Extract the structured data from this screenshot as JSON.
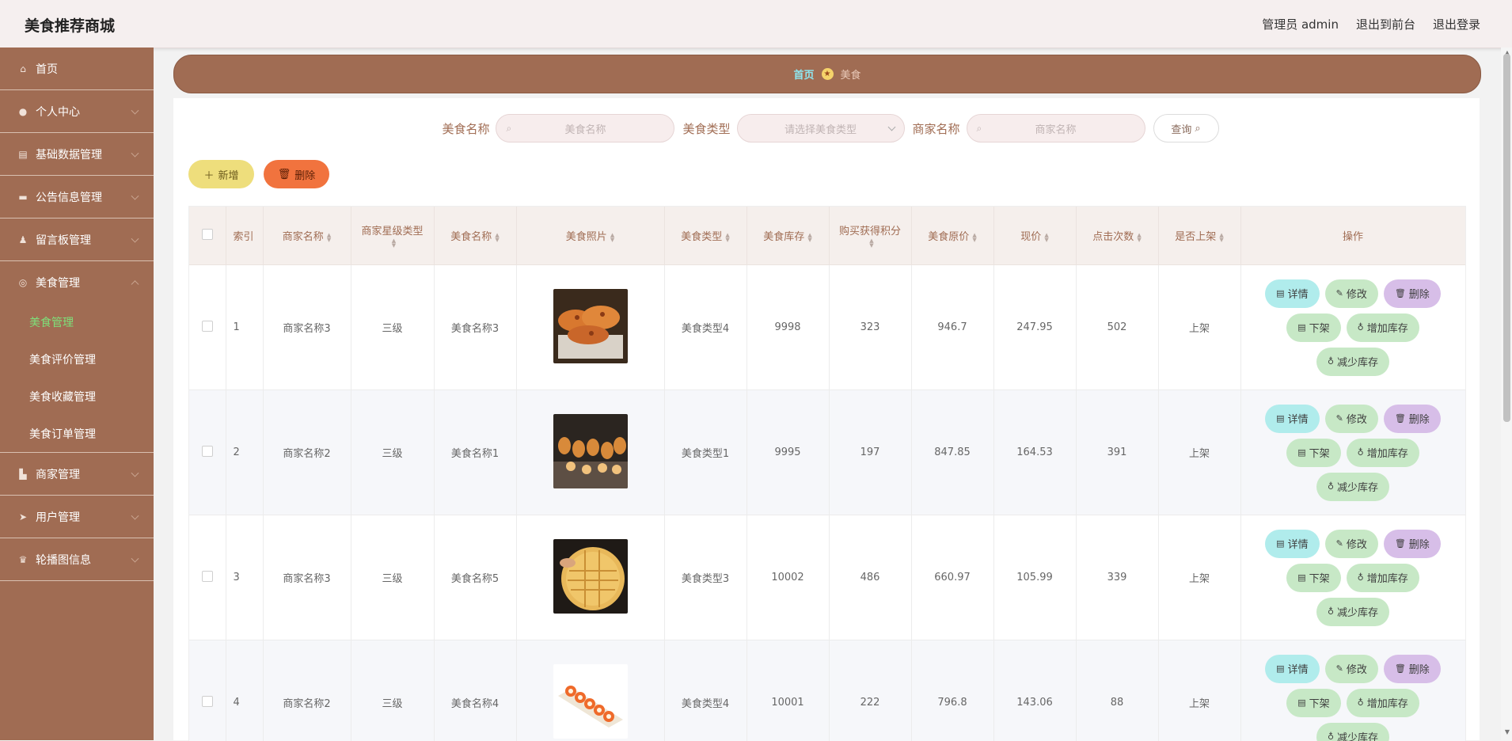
{
  "header": {
    "app_title": "美食推荐商城",
    "admin_label": "管理员 admin",
    "front_link": "退出到前台",
    "logout_link": "退出登录"
  },
  "sidebar": {
    "items": [
      {
        "label": "首页",
        "icon": "home-icon"
      },
      {
        "label": "个人中心",
        "icon": "user-icon"
      },
      {
        "label": "基础数据管理",
        "icon": "clipboard-icon"
      },
      {
        "label": "公告信息管理",
        "icon": "truck-icon"
      },
      {
        "label": "留言板管理",
        "icon": "person-icon"
      },
      {
        "label": "美食管理",
        "icon": "globe-icon"
      }
    ],
    "sub_items": [
      "美食管理",
      "美食评价管理",
      "美食收藏管理",
      "美食订单管理"
    ],
    "items_after": [
      {
        "label": "商家管理",
        "icon": "store-icon"
      },
      {
        "label": "用户管理",
        "icon": "send-icon"
      },
      {
        "label": "轮播图信息",
        "icon": "trophy-icon"
      }
    ]
  },
  "breadcrumb": {
    "home": "首页",
    "current": "美食"
  },
  "search": {
    "name_label": "美食名称",
    "name_placeholder": "美食名称",
    "type_label": "美食类型",
    "type_placeholder": "请选择美食类型",
    "merchant_label": "商家名称",
    "merchant_placeholder": "商家名称",
    "query_button": "查询"
  },
  "actions": {
    "add_button": "新增",
    "delete_button": "删除"
  },
  "table": {
    "columns": [
      "索引",
      "商家名称",
      "商家星级类型",
      "美食名称",
      "美食照片",
      "美食类型",
      "美食库存",
      "购买获得积分",
      "美食原价",
      "现价",
      "点击次数",
      "是否上架",
      "操作"
    ],
    "op_labels": {
      "detail": "详情",
      "edit": "修改",
      "delete": "删除",
      "off_shelf": "下架",
      "inc_stock": "增加库存",
      "dec_stock": "减少库存"
    },
    "rows": [
      {
        "index": "1",
        "merchant": "商家名称3",
        "star": "三级",
        "name": "美食名称3",
        "type": "美食类型4",
        "stock": "9998",
        "points": "323",
        "orig_price": "946.7",
        "price": "247.95",
        "clicks": "502",
        "on_shelf": "上架",
        "photo": "pancake-photo"
      },
      {
        "index": "2",
        "merchant": "商家名称2",
        "star": "三级",
        "name": "美食名称1",
        "type": "美食类型1",
        "stock": "9995",
        "points": "197",
        "orig_price": "847.85",
        "price": "164.53",
        "clicks": "391",
        "on_shelf": "上架",
        "photo": "bbq-skewer-photo"
      },
      {
        "index": "3",
        "merchant": "商家名称3",
        "star": "三级",
        "name": "美食名称5",
        "type": "美食类型3",
        "stock": "10002",
        "points": "486",
        "orig_price": "660.97",
        "price": "105.99",
        "clicks": "339",
        "on_shelf": "上架",
        "photo": "flatbread-photo"
      },
      {
        "index": "4",
        "merchant": "商家名称2",
        "star": "三级",
        "name": "美食名称4",
        "type": "美食类型4",
        "stock": "10001",
        "points": "222",
        "orig_price": "796.8",
        "price": "143.06",
        "clicks": "88",
        "on_shelf": "上架",
        "photo": "sushi-roll-photo"
      }
    ]
  },
  "colors": {
    "sidebar_bg": "#a06c53",
    "active_sub": "#7ee07a",
    "breadcrumb_home": "#8ee6ef"
  }
}
